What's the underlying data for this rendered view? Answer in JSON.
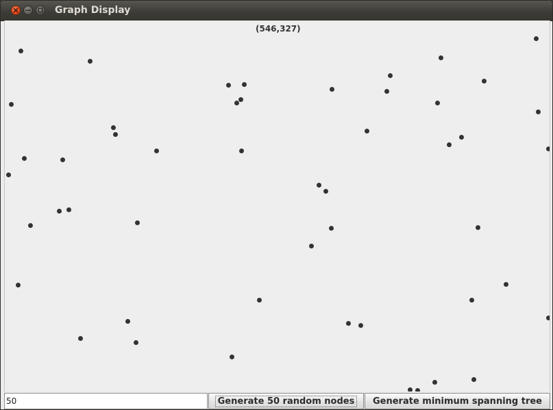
{
  "window": {
    "title": "Graph Display"
  },
  "canvas": {
    "cursor_coordinate": "(546,327)",
    "node_count": 50,
    "node_color": "#333333",
    "background_color": "#eeeeee"
  },
  "controls": {
    "node_count_value": "50",
    "generate_nodes_label": "Generate 50 random nodes",
    "generate_mst_label": "Generate minimum spanning tree"
  }
}
